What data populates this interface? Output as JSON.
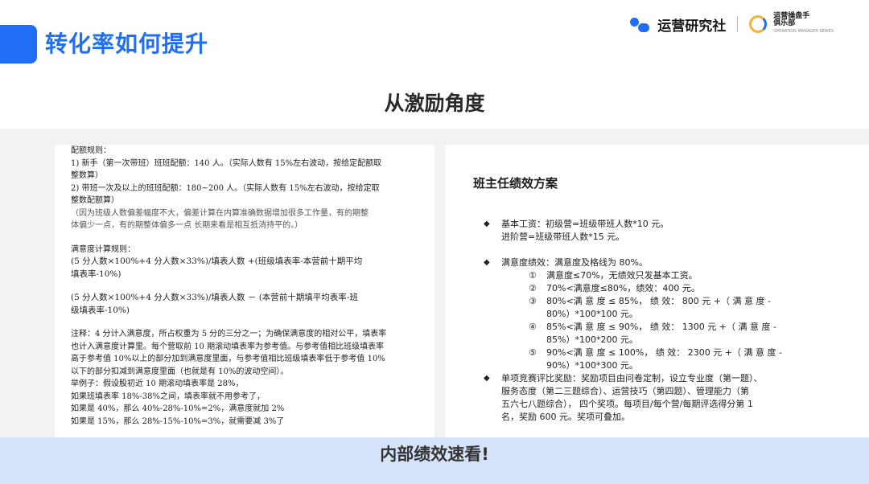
{
  "header": {
    "title": "转化率如何提升",
    "brand": "运营研究社",
    "club_line1": "运营操盘手",
    "club_line2": "俱乐部",
    "club_small": "OPERATION MANAGER SERIES",
    "accent_color": "#1f6ef5"
  },
  "section": {
    "title": "从激励角度"
  },
  "left_doc": {
    "lines": [
      "配额规则：",
      "1)   新手（第一次带班）班班配额：140 人。（实际人数有 15%左右波动，按给定配额取",
      "      整数算）",
      "2)   带班一次及以上的班班配额：180~200 人。（实际人数有 15%左右波动，按给定取",
      "      整数配额算）",
      "      （因为班级人数偏差幅度不大，偏差计算在内算准确数据增加很多工作量，有的期整",
      "      体偏少一点，有的期整体偏多一点  长期来看是相互抵消持平的。）",
      "",
      "满意度计算规则：",
      "(5 分人数×100%+4 分人数×33%)/填表人数    +(班级填表率-本营前十期平均",
      "填表率-10%)",
      "",
      "(5 分人数×100%+4 分人数×33%)/填表人数    －  (本营前十期填平均表率-班",
      "级填表率-10%)",
      "",
      "注释：4 分计入满意度，所占权重为 5 分的三分之一；为确保满意度的相对公平，填表率",
      "也计入满意度计算里。每个营取前 10 期滚动填表率为参考值。与参考值相比班级填表率",
      "高于参考值 10%以上的部分加到满意度里面，与参考值相比班级填表率低于参考值 10%",
      "以下的部分扣减到满意度里面（也就是有 10%的波动空间）。",
      "举例子：假设股初近 10 期滚动填表率是 28%，",
      "如果班填表率 18%-38%之间，填表率就不用参考了，",
      "如果是 40%，那么 40%-28%-10%=2%，满意度就加 2%",
      "如果是 15%，那么 28%-15%-10%=3%，就需要减 3%了"
    ]
  },
  "right_doc": {
    "title": "班主任绩效方案",
    "rows": [
      {
        "bullet": "◆",
        "text": "基本工资：初级营=班级带班人数*10 元。"
      },
      {
        "text": "               进阶营=班级带班人数*15 元。"
      },
      {
        "gap": true
      },
      {
        "bullet": "◆",
        "text": "满意度绩效：满意度及格线为 80%。"
      },
      {
        "circ": "①",
        "text": "满意度≤70%，无绩效只发基本工资。"
      },
      {
        "circ": "②",
        "text": "70%<满意度≤80%，绩效：400 元。"
      },
      {
        "circ": "③",
        "text": "80%<满 意 度 ≤ 85%， 绩 效： 800 元 +（ 满 意 度 -"
      },
      {
        "circ": "",
        "text": "80%）*100*100 元。"
      },
      {
        "circ": "④",
        "text": "85%<满 意 度 ≤ 90%， 绩 效： 1300 元 +（ 满 意 度 -"
      },
      {
        "circ": "",
        "text": "85%）*100*200 元。"
      },
      {
        "circ": "⑤",
        "text": "90%<满 意 度 ≤ 100%， 绩 效： 2300 元 +（ 满 意 度 -"
      },
      {
        "circ": "",
        "text": "90%）*100*300 元。"
      },
      {
        "bullet": "◆",
        "text": "单项竞赛评比奖励：奖励项目由问卷定制，设立专业度（第一题）、"
      },
      {
        "text": "服务态度（第二三题综合）、运营技巧（第四题）、管理能力（第"
      },
      {
        "text": "五六七八题综合），   四个奖项。每项目/每个营/每期评选得分第 1"
      },
      {
        "text": "名，奖励 600 元。奖项可叠加。"
      }
    ]
  },
  "footer": {
    "text": "内部绩效速看!"
  }
}
